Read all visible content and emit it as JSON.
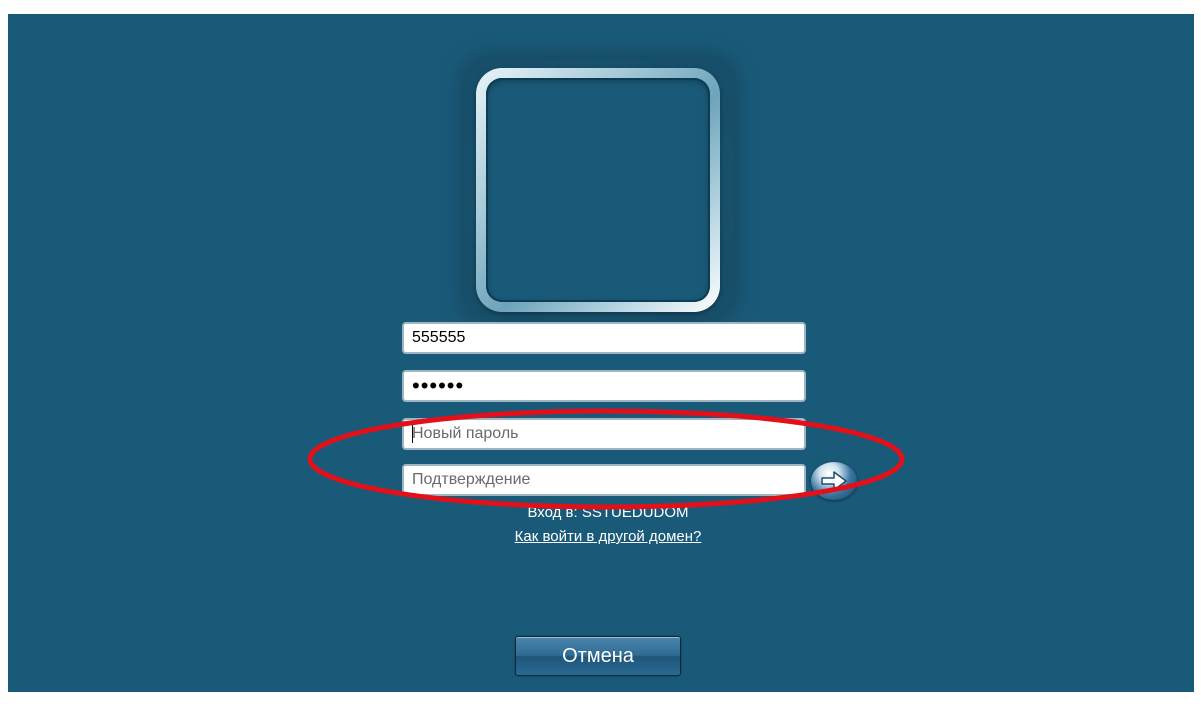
{
  "login": {
    "username_value": "555555",
    "password_value": "••••••",
    "new_password_placeholder": "Новый пароль",
    "confirm_placeholder": "Подтверждение",
    "domain_text": "Вход в: SSTUEDUDOM",
    "other_domain_link": "Как войти в другой домен?",
    "cancel_label": "Отмена"
  },
  "icons": {
    "submit": "arrow-right-icon",
    "avatar": "user-picture-frame"
  },
  "colors": {
    "background": "#1a5a79",
    "annotation": "#e3101a"
  }
}
